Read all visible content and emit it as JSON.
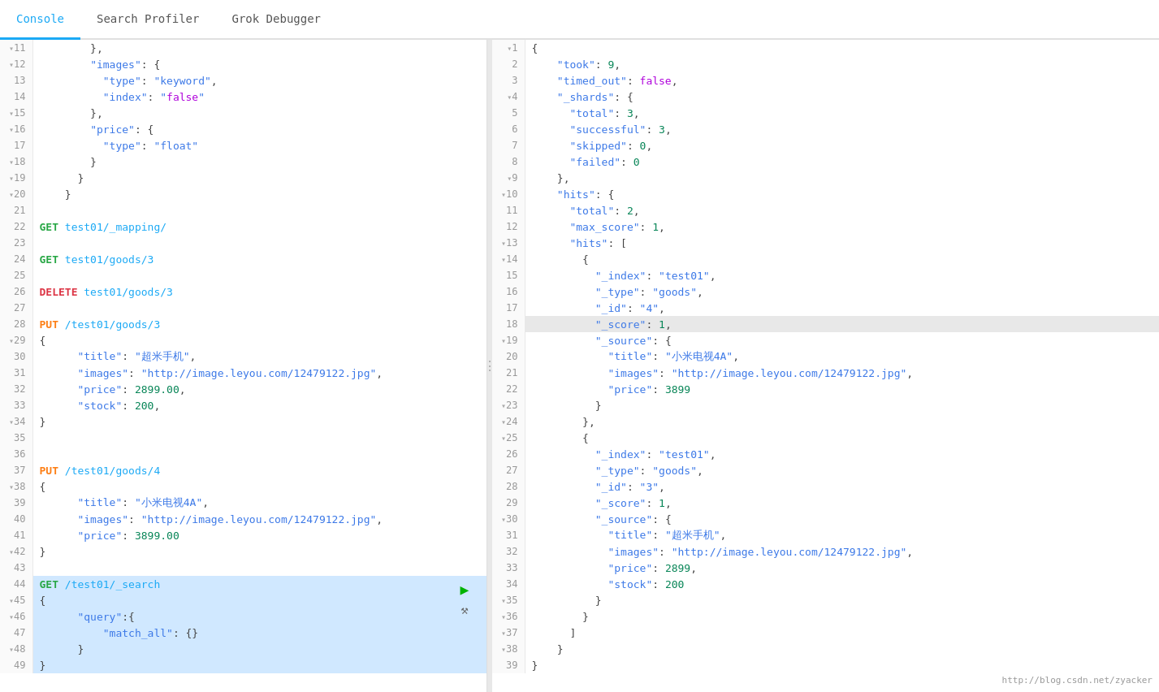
{
  "tabs": [
    {
      "id": "console",
      "label": "Console",
      "active": true
    },
    {
      "id": "search-profiler",
      "label": "Search Profiler",
      "active": false
    },
    {
      "id": "grok-debugger",
      "label": "Grok Debugger",
      "active": false
    }
  ],
  "left_panel": {
    "lines": [
      {
        "num": 11,
        "fold": true,
        "code": "        },",
        "highlight": false
      },
      {
        "num": 12,
        "fold": true,
        "code": "        \"images\": {",
        "highlight": false
      },
      {
        "num": 13,
        "fold": false,
        "code": "          \"type\": \"keyword\",",
        "highlight": false
      },
      {
        "num": 14,
        "fold": false,
        "code": "          \"index\": \"false\"",
        "highlight": false
      },
      {
        "num": 15,
        "fold": true,
        "code": "        },",
        "highlight": false
      },
      {
        "num": 16,
        "fold": true,
        "code": "        \"price\": {",
        "highlight": false
      },
      {
        "num": 17,
        "fold": false,
        "code": "          \"type\": \"float\"",
        "highlight": false
      },
      {
        "num": 18,
        "fold": true,
        "code": "        }",
        "highlight": false
      },
      {
        "num": 19,
        "fold": true,
        "code": "      }",
        "highlight": false
      },
      {
        "num": 20,
        "fold": true,
        "code": "    }",
        "highlight": false
      },
      {
        "num": 21,
        "fold": false,
        "code": "",
        "highlight": false
      },
      {
        "num": 22,
        "fold": false,
        "code": "GET test01/_mapping/",
        "type": "request",
        "method": "GET",
        "url": "test01/_mapping/",
        "highlight": false
      },
      {
        "num": 23,
        "fold": false,
        "code": "",
        "highlight": false
      },
      {
        "num": 24,
        "fold": false,
        "code": "GET test01/goods/3",
        "type": "request",
        "method": "GET",
        "url": "test01/goods/3",
        "highlight": false
      },
      {
        "num": 25,
        "fold": false,
        "code": "",
        "highlight": false
      },
      {
        "num": 26,
        "fold": false,
        "code": "DELETE test01/goods/3",
        "type": "request",
        "method": "DELETE",
        "url": "test01/goods/3",
        "highlight": false
      },
      {
        "num": 27,
        "fold": false,
        "code": "",
        "highlight": false
      },
      {
        "num": 28,
        "fold": false,
        "code": "PUT /test01/goods/3",
        "type": "request",
        "method": "PUT",
        "url": "/test01/goods/3",
        "highlight": false
      },
      {
        "num": 29,
        "fold": true,
        "code": "{",
        "highlight": false
      },
      {
        "num": 30,
        "fold": false,
        "code": "      \"title\":\"超米手机\",",
        "highlight": false
      },
      {
        "num": 31,
        "fold": false,
        "code": "      \"images\":\"http://image.leyou.com/12479122.jpg\",",
        "highlight": false
      },
      {
        "num": 32,
        "fold": false,
        "code": "      \"price\":2899.00,",
        "highlight": false
      },
      {
        "num": 33,
        "fold": false,
        "code": "      \"stock\": 200,",
        "highlight": false
      },
      {
        "num": 34,
        "fold": true,
        "code": "}",
        "highlight": false
      },
      {
        "num": 35,
        "fold": false,
        "code": "",
        "highlight": false
      },
      {
        "num": 36,
        "fold": false,
        "code": "",
        "highlight": false
      },
      {
        "num": 37,
        "fold": false,
        "code": "PUT /test01/goods/4",
        "type": "request",
        "method": "PUT",
        "url": "/test01/goods/4",
        "highlight": false
      },
      {
        "num": 38,
        "fold": true,
        "code": "{",
        "highlight": false
      },
      {
        "num": 39,
        "fold": false,
        "code": "      \"title\":\"小米电视4A\",",
        "highlight": false
      },
      {
        "num": 40,
        "fold": false,
        "code": "      \"images\":\"http://image.leyou.com/12479122.jpg\",",
        "highlight": false
      },
      {
        "num": 41,
        "fold": false,
        "code": "      \"price\":3899.00",
        "highlight": false
      },
      {
        "num": 42,
        "fold": true,
        "code": "}",
        "highlight": false
      },
      {
        "num": 43,
        "fold": false,
        "code": "",
        "highlight": false
      },
      {
        "num": 44,
        "fold": false,
        "code": "GET /test01/_search",
        "type": "request",
        "method": "GET",
        "url": "/test01/_search",
        "highlight": true
      },
      {
        "num": 45,
        "fold": true,
        "code": "{",
        "highlight": true
      },
      {
        "num": 46,
        "fold": true,
        "code": "      \"query\":{",
        "highlight": true
      },
      {
        "num": 47,
        "fold": false,
        "code": "          \"match_all\": {}",
        "highlight": true
      },
      {
        "num": 48,
        "fold": true,
        "code": "      }",
        "highlight": true
      },
      {
        "num": 49,
        "fold": false,
        "code": "}",
        "highlight": true
      }
    ]
  },
  "right_panel": {
    "lines": [
      {
        "num": 1,
        "fold": true,
        "code": "{",
        "highlight": false
      },
      {
        "num": 2,
        "fold": false,
        "code": "    \"took\": 9,",
        "highlight": false
      },
      {
        "num": 3,
        "fold": false,
        "code": "    \"timed_out\": false,",
        "highlight": false
      },
      {
        "num": 4,
        "fold": true,
        "code": "    \"_shards\": {",
        "highlight": false
      },
      {
        "num": 5,
        "fold": false,
        "code": "      \"total\": 3,",
        "highlight": false
      },
      {
        "num": 6,
        "fold": false,
        "code": "      \"successful\": 3,",
        "highlight": false
      },
      {
        "num": 7,
        "fold": false,
        "code": "      \"skipped\": 0,",
        "highlight": false
      },
      {
        "num": 8,
        "fold": false,
        "code": "      \"failed\": 0",
        "highlight": false
      },
      {
        "num": 9,
        "fold": true,
        "code": "    },",
        "highlight": false
      },
      {
        "num": 10,
        "fold": true,
        "code": "    \"hits\": {",
        "highlight": false
      },
      {
        "num": 11,
        "fold": false,
        "code": "      \"total\": 2,",
        "highlight": false
      },
      {
        "num": 12,
        "fold": false,
        "code": "      \"max_score\": 1,",
        "highlight": false
      },
      {
        "num": 13,
        "fold": true,
        "code": "      \"hits\": [",
        "highlight": false
      },
      {
        "num": 14,
        "fold": true,
        "code": "        {",
        "highlight": false
      },
      {
        "num": 15,
        "fold": false,
        "code": "          \"_index\": \"test01\",",
        "highlight": false
      },
      {
        "num": 16,
        "fold": false,
        "code": "          \"_type\": \"goods\",",
        "highlight": false
      },
      {
        "num": 17,
        "fold": false,
        "code": "          \"_id\": \"4\",",
        "highlight": false
      },
      {
        "num": 18,
        "fold": false,
        "code": "          \"_score\": 1,",
        "highlight": true
      },
      {
        "num": 19,
        "fold": true,
        "code": "          \"_source\": {",
        "highlight": false
      },
      {
        "num": 20,
        "fold": false,
        "code": "            \"title\": \"小米电视4A\",",
        "highlight": false
      },
      {
        "num": 21,
        "fold": false,
        "code": "            \"images\": \"http://image.leyou.com/12479122.jpg\",",
        "highlight": false
      },
      {
        "num": 22,
        "fold": false,
        "code": "            \"price\": 3899",
        "highlight": false
      },
      {
        "num": 23,
        "fold": true,
        "code": "          }",
        "highlight": false
      },
      {
        "num": 24,
        "fold": true,
        "code": "        },",
        "highlight": false
      },
      {
        "num": 25,
        "fold": true,
        "code": "        {",
        "highlight": false
      },
      {
        "num": 26,
        "fold": false,
        "code": "          \"_index\": \"test01\",",
        "highlight": false
      },
      {
        "num": 27,
        "fold": false,
        "code": "          \"_type\": \"goods\",",
        "highlight": false
      },
      {
        "num": 28,
        "fold": false,
        "code": "          \"_id\": \"3\",",
        "highlight": false
      },
      {
        "num": 29,
        "fold": false,
        "code": "          \"_score\": 1,",
        "highlight": false
      },
      {
        "num": 30,
        "fold": true,
        "code": "          \"_source\": {",
        "highlight": false
      },
      {
        "num": 31,
        "fold": false,
        "code": "            \"title\": \"超米手机\",",
        "highlight": false
      },
      {
        "num": 32,
        "fold": false,
        "code": "            \"images\": \"http://image.leyou.com/12479122.jpg\",",
        "highlight": false
      },
      {
        "num": 33,
        "fold": false,
        "code": "            \"price\": 2899,",
        "highlight": false
      },
      {
        "num": 34,
        "fold": false,
        "code": "            \"stock\": 200",
        "highlight": false
      },
      {
        "num": 35,
        "fold": true,
        "code": "          }",
        "highlight": false
      },
      {
        "num": 36,
        "fold": true,
        "code": "        }",
        "highlight": false
      },
      {
        "num": 37,
        "fold": true,
        "code": "      ]",
        "highlight": false
      },
      {
        "num": 38,
        "fold": true,
        "code": "    }",
        "highlight": false
      },
      {
        "num": 39,
        "fold": false,
        "code": "}",
        "highlight": false
      }
    ]
  },
  "watermark": "http://blog.csdn.net/zyacker"
}
